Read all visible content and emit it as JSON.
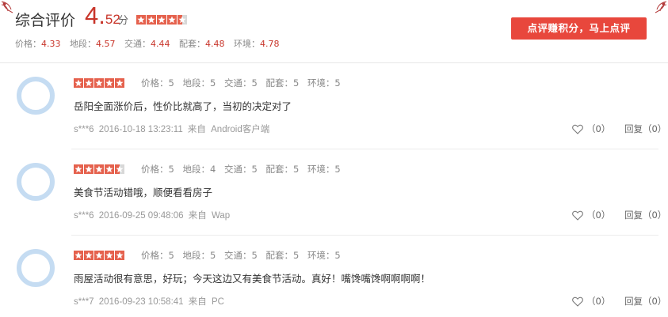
{
  "summary": {
    "title": "综合评价",
    "score_int": "4.",
    "score_dec": "52",
    "score_unit": "分",
    "stars": 4.5,
    "sub_scores": [
      {
        "label": "价格：",
        "value": "4.33"
      },
      {
        "label": "地段：",
        "value": "4.57"
      },
      {
        "label": "交通：",
        "value": "4.44"
      },
      {
        "label": "配套：",
        "value": "4.48"
      },
      {
        "label": "环境：",
        "value": "4.78"
      }
    ]
  },
  "cta": {
    "label": "点评赚积分，马上点评"
  },
  "colors": {
    "accent": "#c8352a",
    "button": "#e8473c",
    "star": "#e5614d",
    "star_empty": "#d8d8d8",
    "avatar": "#c5dcf2"
  },
  "reviews": [
    {
      "stars": 5,
      "scores": [
        "价格：5",
        "地段：5",
        "交通：5",
        "配套：5",
        "环境：5"
      ],
      "text": "岳阳全面涨价后，性价比就高了，当初的决定对了",
      "user": "s***6",
      "date": "2016-10-18 13:23:11",
      "source_label": "来自",
      "source": "Android客户端",
      "like": "（0）",
      "reply_label": "回复（0）"
    },
    {
      "stars": 4.5,
      "scores": [
        "价格：5",
        "地段：4",
        "交通：5",
        "配套：5",
        "环境：5"
      ],
      "text": "美食节活动错哦，顺便看看房子",
      "user": "s***6",
      "date": "2016-09-25 09:48:06",
      "source_label": "来自",
      "source": "Wap",
      "like": "（0）",
      "reply_label": "回复（0）"
    },
    {
      "stars": 5,
      "scores": [
        "价格：5",
        "地段：5",
        "交通：5",
        "配套：5",
        "环境：5"
      ],
      "text": "雨屋活动很有意思，好玩；今天这边又有美食节活动。真好！嘴馋嘴馋啊啊啊啊！",
      "user": "s***7",
      "date": "2016-09-23 10:58:41",
      "source_label": "来自",
      "source": "PC",
      "like": "（0）",
      "reply_label": "回复（0）"
    }
  ]
}
